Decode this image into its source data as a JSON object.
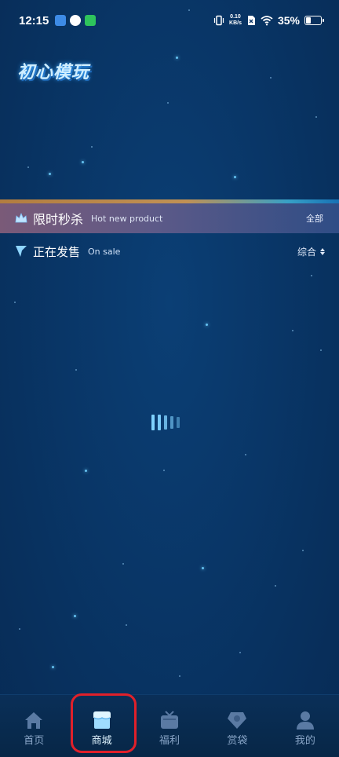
{
  "status_bar": {
    "time": "12:15",
    "net_speed_value": "0.10",
    "net_speed_unit": "KB/s",
    "battery_percent": "35%",
    "battery_level": 0.35
  },
  "app": {
    "logo_text": "初心模玩"
  },
  "flash_sale": {
    "title": "限时秒杀",
    "subtitle": "Hot new product",
    "more_label": "全部"
  },
  "on_sale": {
    "title": "正在发售",
    "subtitle": "On sale",
    "sort_label": "综合"
  },
  "tabs": [
    {
      "label": "首页",
      "icon": "home-icon"
    },
    {
      "label": "商城",
      "icon": "shop-icon",
      "active": true
    },
    {
      "label": "福利",
      "icon": "gift-tv-icon"
    },
    {
      "label": "赏袋",
      "icon": "reward-bag-icon"
    },
    {
      "label": "我的",
      "icon": "profile-icon"
    }
  ],
  "colors": {
    "background": "#093667",
    "accent": "#6fd0ff",
    "highlight_box": "#e0202a",
    "tab_inactive": "#8aa6c8"
  }
}
